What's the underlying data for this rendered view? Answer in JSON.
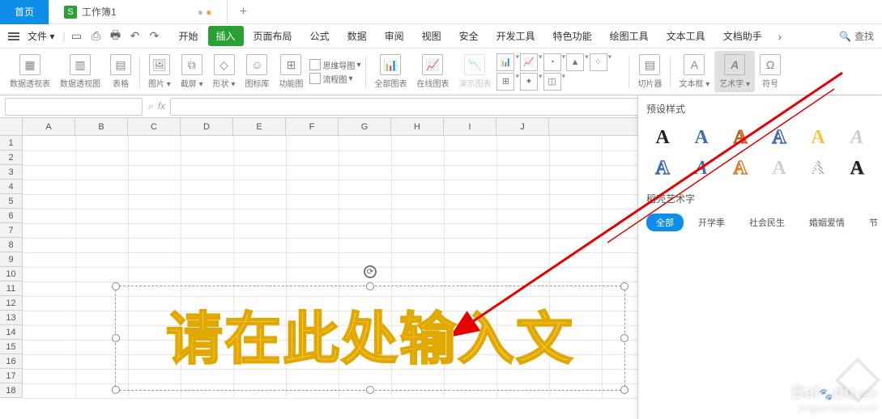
{
  "tabs": {
    "home": "首页",
    "workbook": "工作簿1",
    "add": "+"
  },
  "menu": {
    "file": "文件",
    "items": [
      "开始",
      "插入",
      "页面布局",
      "公式",
      "数据",
      "审阅",
      "视图",
      "安全",
      "开发工具",
      "特色功能",
      "绘图工具",
      "文本工具",
      "文档助手"
    ],
    "search": "查找"
  },
  "ribbon": {
    "pivottable": "数据透视表",
    "pivotchart": "数据透视图",
    "table": "表格",
    "picture": "图片",
    "screenshot": "截屏",
    "shapes": "形状",
    "icons": "图标库",
    "funcchart": "功能图",
    "mindmap": "思维导图",
    "flowchart": "流程图",
    "allcharts": "全部图表",
    "onlinecharts": "在线图表",
    "demochart": "演示图表",
    "slicer": "切片器",
    "textbox": "文本框",
    "wordart": "艺术字",
    "symbol": "符号"
  },
  "cols": [
    "A",
    "B",
    "C",
    "D",
    "E",
    "F",
    "G",
    "H",
    "I",
    "J"
  ],
  "rows": [
    "1",
    "2",
    "3",
    "4",
    "5",
    "6",
    "7",
    "8",
    "9",
    "10",
    "11",
    "12",
    "13",
    "14",
    "15",
    "16",
    "17",
    "18"
  ],
  "wordart_text": "请在此处输入文",
  "flyout": {
    "presets_title": "预设样式",
    "dkwordart": "稻壳艺术字",
    "chips": [
      "全部",
      "开学季",
      "社会民生",
      "婚姻爱情",
      "节"
    ]
  },
  "watermark": {
    "brand": "Bai",
    "du": "du",
    "exp": "经验",
    "url": "jingyan.baidu.com"
  }
}
